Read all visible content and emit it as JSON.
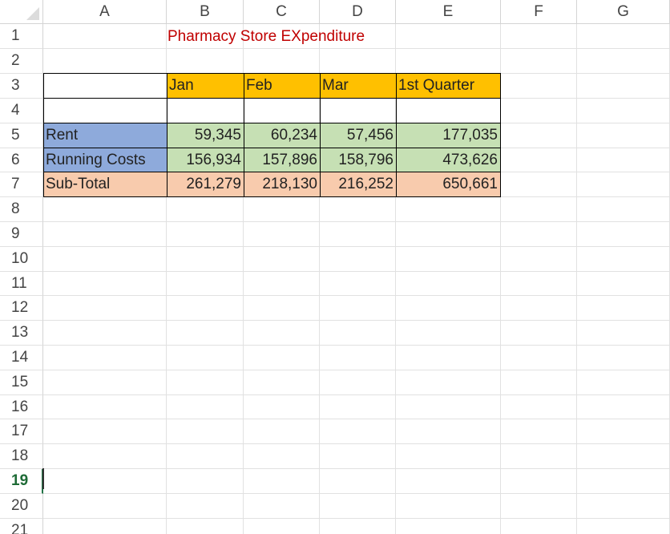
{
  "columns": [
    "A",
    "B",
    "C",
    "D",
    "E",
    "F",
    "G"
  ],
  "rows": [
    "1",
    "2",
    "3",
    "4",
    "5",
    "6",
    "7",
    "8",
    "9",
    "10",
    "11",
    "12",
    "13",
    "14",
    "15",
    "16",
    "17",
    "18",
    "19",
    "20",
    "21"
  ],
  "active_row": "19",
  "cells": {
    "title": "Pharmacy Store EXpenditure",
    "headers": [
      "Jan",
      "Feb",
      "Mar",
      "1st Quarter"
    ],
    "rent": {
      "label": "Rent",
      "values": [
        "59,345",
        "60,234",
        "57,456",
        "177,035"
      ]
    },
    "running": {
      "label": "Running Costs",
      "values": [
        "156,934",
        "157,896",
        "158,796",
        "473,626"
      ]
    },
    "subtotal": {
      "label": "Sub-Total",
      "values": [
        "261,279",
        "218,130",
        "216,252",
        "650,661"
      ]
    }
  },
  "colors": {
    "title": "#c00000",
    "header_fill": "#ffc000",
    "value_fill": "#c6e0b4",
    "label_fill": "#8eaadb",
    "subtotal_fill": "#f8cbad"
  }
}
